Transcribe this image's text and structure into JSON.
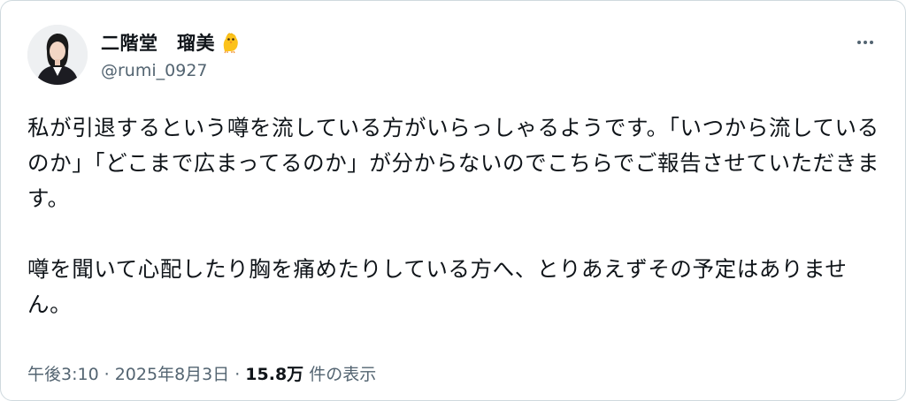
{
  "author": {
    "display_name": "二階堂　瑠美",
    "emoji_icon": "baby-chick-icon",
    "handle": "@rumi_0927"
  },
  "post": {
    "paragraphs": [
      "私が引退するという噂を流している方がいらっしゃるようです。「いつから流しているのか」「どこまで広まってるのか」が分からないのでこちらでご報告させていただきます。",
      "噂を聞いて心配したり胸を痛めたりしている方へ、とりあえずその予定はありません。"
    ]
  },
  "meta": {
    "time": "午後3:10",
    "separator": "·",
    "date": "2025年8月3日",
    "view_count": "15.8万",
    "view_label": "件の表示"
  },
  "colors": {
    "text": "#0f1419",
    "secondary": "#536471",
    "border": "#cfd9de"
  }
}
